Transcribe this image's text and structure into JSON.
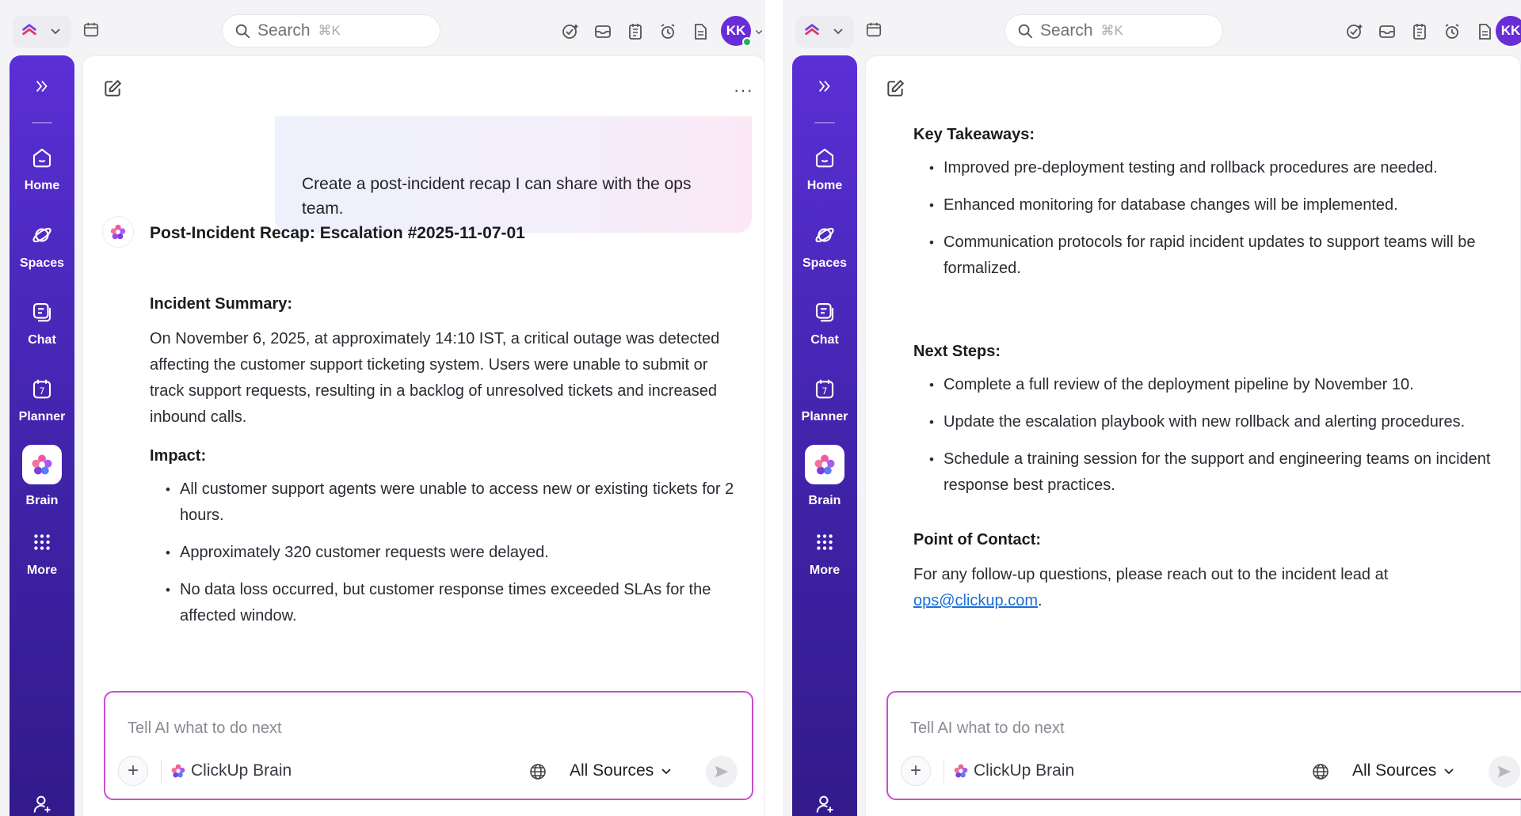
{
  "nav": {
    "items": [
      {
        "label": "Home",
        "icon": "home-icon"
      },
      {
        "label": "Spaces",
        "icon": "spaces-icon"
      },
      {
        "label": "Chat",
        "icon": "chat-icon"
      },
      {
        "label": "Planner",
        "icon": "planner-icon"
      },
      {
        "label": "Brain",
        "icon": "brain-icon"
      },
      {
        "label": "More",
        "icon": "grid-icon"
      }
    ]
  },
  "topbar": {
    "search_label": "Search",
    "search_shortcut": "⌘K",
    "avatar_initials": "KK"
  },
  "left": {
    "user_message": "Create a post-incident recap I can share with the ops team.",
    "recap_title": "Post-Incident Recap: Escalation #2025-11-07-01",
    "summary_heading": "Incident Summary:",
    "summary_text": "On November 6, 2025, at approximately 14:10 IST, a critical outage was detected affecting the customer support ticketing system. Users were unable to submit or track support requests, resulting in a backlog of unresolved tickets and increased inbound calls.",
    "impact_heading": "Impact:",
    "impact_items": [
      "All customer support agents were unable to access new or existing tickets for 2 hours.",
      "Approximately 320 customer requests were delayed.",
      "No data loss occurred, but customer response times exceeded SLAs for the affected window."
    ]
  },
  "right": {
    "takeaways_heading": "Key Takeaways:",
    "takeaways_items": [
      "Improved pre-deployment testing and rollback procedures are needed.",
      "Enhanced monitoring for database changes will be implemented.",
      "Communication protocols for rapid incident updates to support teams will be formalized."
    ],
    "next_heading": "Next Steps:",
    "next_items": [
      "Complete a full review of the deployment pipeline by November 10.",
      "Update the escalation playbook with new rollback and alerting procedures.",
      "Schedule a training session for the support and engineering teams on incident response best practices."
    ],
    "contact_heading": "Point of Contact:",
    "contact_text": "For any follow-up questions, please reach out to the incident lead at",
    "contact_email": "ops@clickup.com",
    "contact_end": "."
  },
  "input": {
    "placeholder": "Tell AI what to do next",
    "brain_label": "ClickUp Brain",
    "sources_label": "All Sources"
  },
  "colors": {
    "sidebar": "#4a28b8",
    "accent": "#7b3fe4",
    "input_border": "#c64fcf",
    "link": "#1a6fd6"
  }
}
